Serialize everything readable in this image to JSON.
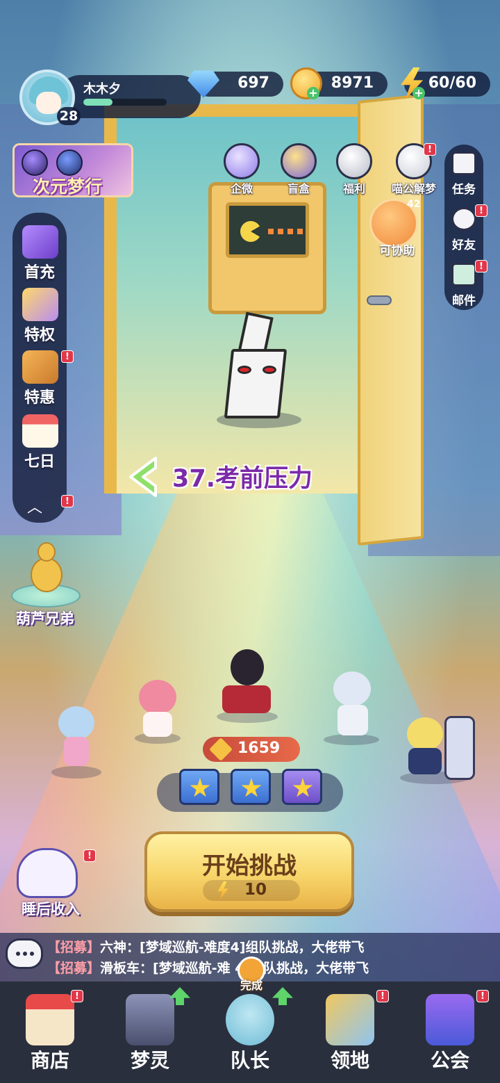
{
  "player": {
    "name": "木木夕",
    "level": "28",
    "xp_fraction": 0.35
  },
  "resources": {
    "gems": "697",
    "coins": "8971",
    "energy": "60/60"
  },
  "event_banner": {
    "title": "次元梦行"
  },
  "left_menu": [
    {
      "label": "首充",
      "icon": "hammer-icon",
      "badge": false
    },
    {
      "label": "特权",
      "icon": "privilege-cards-icon",
      "badge": false
    },
    {
      "label": "特惠",
      "icon": "gift-box-icon",
      "badge": true
    },
    {
      "label": "七日",
      "icon": "calendar-icon",
      "badge": false
    }
  ],
  "hulu": {
    "label": "葫芦兄弟"
  },
  "top_icons": [
    {
      "label": "企微",
      "icon": "gift-icon"
    },
    {
      "label": "盲盒",
      "icon": "blind-box-icon"
    },
    {
      "label": "福利",
      "icon": "welfare-icon"
    },
    {
      "label": "喵公解梦",
      "icon": "cat-icon"
    }
  ],
  "right_menu": [
    {
      "label": "任务",
      "icon": "task-icon"
    },
    {
      "label": "好友",
      "icon": "friends-icon"
    },
    {
      "label": "邮件",
      "icon": "mail-icon"
    }
  ],
  "assist": {
    "label": "可协助",
    "count": "42"
  },
  "stage": {
    "title": "37.考前压力"
  },
  "team": {
    "power": "1659"
  },
  "start_button": {
    "label": "开始挑战",
    "cost": "10"
  },
  "sleep_income": {
    "label": "睡后收入"
  },
  "chat": [
    {
      "tag": "【招募】",
      "text": "六神：[梦域巡航-难度4]组队挑战，大佬带飞"
    },
    {
      "tag": "【招募】",
      "text": "滑板车：[梦域巡航-难 4]组队挑战，大佬带飞"
    }
  ],
  "leader_status": "完成",
  "badge_mark": "!",
  "nav": [
    {
      "label": "商店",
      "icon": "shop-icon"
    },
    {
      "label": "梦灵",
      "icon": "robot-icon"
    },
    {
      "label": "队长",
      "icon": "leader-icon"
    },
    {
      "label": "领地",
      "icon": "territory-icon"
    },
    {
      "label": "公会",
      "icon": "guild-icon"
    }
  ],
  "colors": {
    "accent_purple": "#7b2aa8",
    "button_gold": "#f7d56a",
    "badge_red": "#e0384a"
  }
}
